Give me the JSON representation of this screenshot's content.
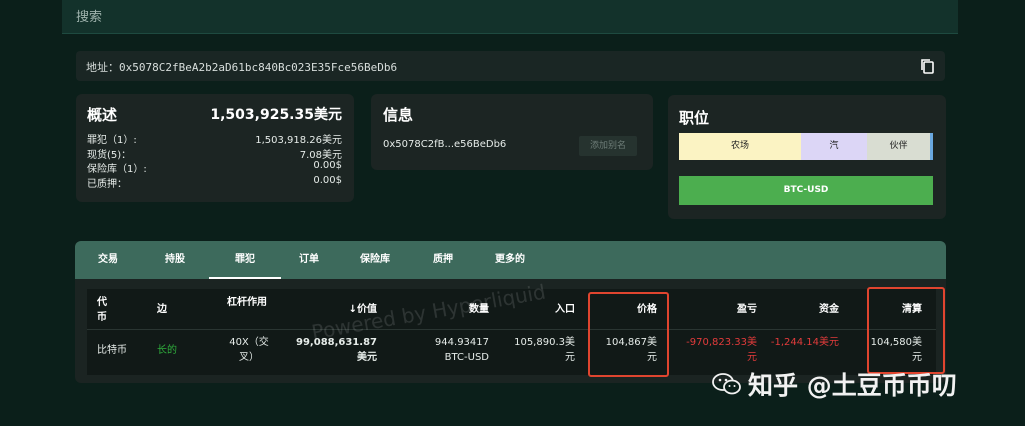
{
  "search": {
    "placeholder": "搜索"
  },
  "address": {
    "label": "地址：0x5078C2fBeA2b2aD61bc840Bc023E35Fce56BeDb6"
  },
  "overview": {
    "title": "概述",
    "total": "1,503,925.35美元",
    "rows": [
      {
        "k": "罪犯（1）:",
        "v": "1,503,918.26美元"
      },
      {
        "k": "现货(5)：",
        "v": "7.08美元"
      },
      {
        "k": "保险库（1）:",
        "v": "0.00$"
      },
      {
        "k": "已质押：",
        "v": "0.00$"
      }
    ]
  },
  "info": {
    "title": "信息",
    "short_addr": "0x5078C2fB...e56BeDb6",
    "alias_button": "添加别名"
  },
  "position": {
    "title": "职位",
    "segments": [
      {
        "label": "农场",
        "color": "#fbf3c3"
      },
      {
        "label": "汽",
        "color": "#dcd6f6"
      },
      {
        "label": "伙伴",
        "color": "#d9ddd2"
      }
    ],
    "btc_label": "BTC-USD",
    "btc_color": "#4cae4f"
  },
  "tabs": [
    "交易",
    "持股",
    "罪犯",
    "订单",
    "保险库",
    "质押",
    "更多的"
  ],
  "table": {
    "headers": {
      "code": "代币",
      "side": "边",
      "leverage": "杠杆作用",
      "value": "↓价值",
      "qty": "数量",
      "entry": "入口",
      "price": "价格",
      "pnl": "盈亏",
      "funding": "资金",
      "liq": "清算"
    },
    "row": {
      "code": "比特币",
      "side": "长的",
      "leverage": "40X（交叉）",
      "value": "99,088,631.87美元",
      "qty": "944.93417 BTC-USD",
      "entry": "105,890.3美元",
      "price": "104,867美元",
      "pnl": "-970,823.33美元",
      "funding": "-1,244.14美元",
      "liq": "104,580美元"
    }
  },
  "watermark": "Powered by Hyperliquid",
  "brand": {
    "text": "知乎 @土豆币币叨"
  }
}
